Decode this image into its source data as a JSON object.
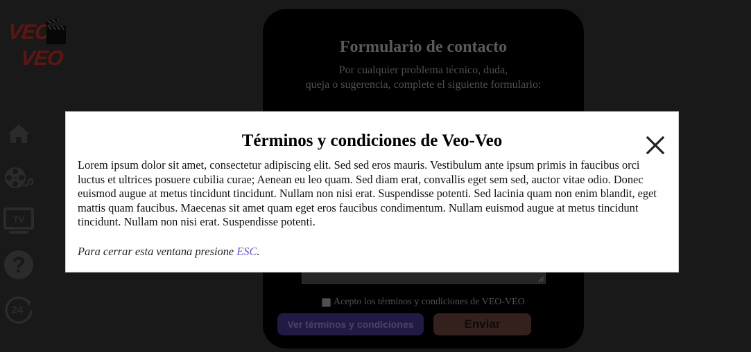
{
  "logo": {
    "line1": "VEO",
    "line2": "VEO",
    "icon": "clapperboard-icon"
  },
  "sidebar": {
    "items": [
      {
        "name": "home",
        "icon": "home-icon"
      },
      {
        "name": "movies",
        "icon": "film-reel-icon"
      },
      {
        "name": "tv",
        "icon": "tv-icon"
      },
      {
        "name": "help",
        "icon": "question-icon"
      },
      {
        "name": "support-24h",
        "icon": "24h-icon"
      }
    ]
  },
  "contact": {
    "title": "Formulario de contacto",
    "subtitle_line1": "Por cualquier problema técnico, duda,",
    "subtitle_line2": "queja o sugerencia, complete el siguiente formulario:",
    "accept_label": "Acepto los términos y condiciones de VEO-VEO",
    "terms_button": "Ver términos y condiciones",
    "send_button": "Enviar"
  },
  "modal": {
    "title": "Términos y condiciones de Veo-Veo",
    "body": "Lorem ipsum dolor sit amet, consectetur adipiscing elit. Sed sed eros mauris. Vestibulum ante ipsum primis in faucibus orci luctus et ultrices posuere cubilia curae; Aenean eu leo quam. Sed diam erat, convallis eget sem sed, auctor vitae odio. Donec euismod augue at metus tincidunt tincidunt. Nullam non nisi erat. Suspendisse potenti. Sed lacinia quam non enim blandit, eget mattis quam faucibus. Maecenas sit amet quam eget eros faucibus condimentum. Nullam euismod augue at metus tincidunt tincidunt. Nullam non nisi erat. Suspendisse potenti.",
    "hint_prefix": "Para cerrar esta ventana presione ",
    "hint_key": "ESC",
    "hint_suffix": "."
  },
  "colors": {
    "background": "#2c2c2c",
    "logo_red": "#a4271f",
    "terms_button": "#4b3a94",
    "send_button": "#9c5f55",
    "hint_key": "#6a55c8"
  }
}
